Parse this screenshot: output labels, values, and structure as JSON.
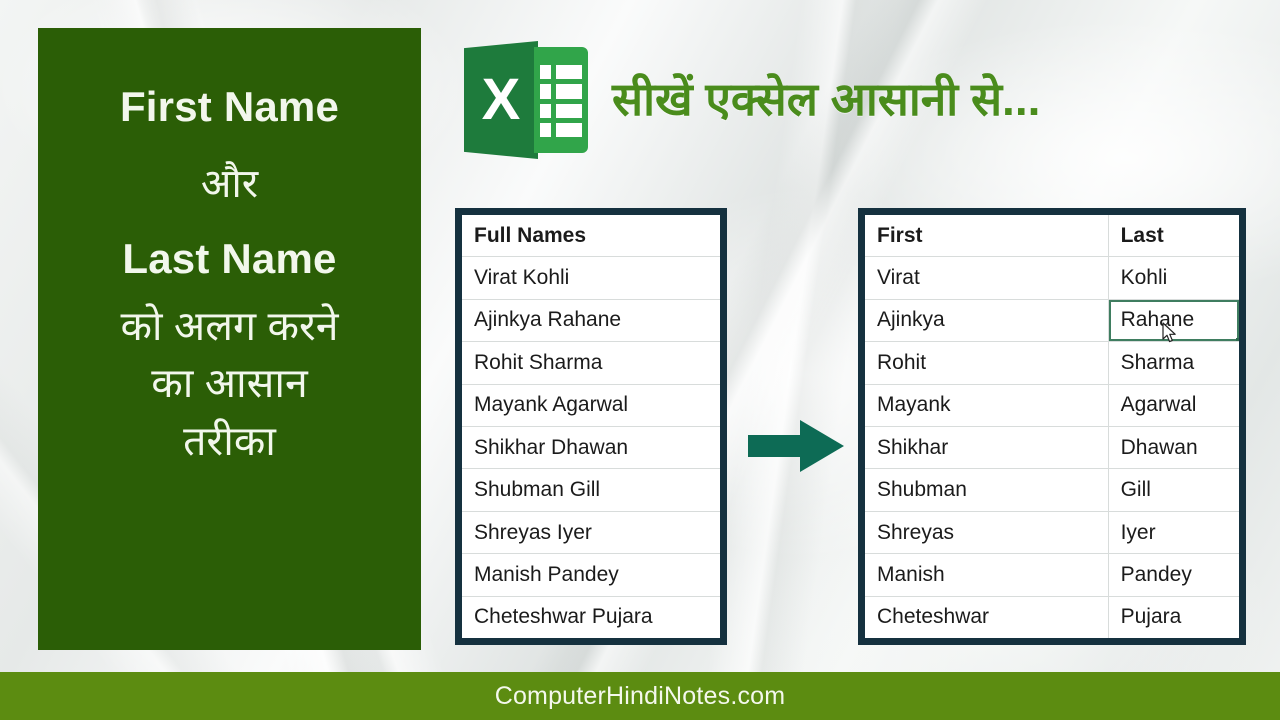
{
  "colors": {
    "panel_green": "#2b5e06",
    "tagline_green": "#4a8c1c",
    "footer_green": "#5c8c11",
    "table_border": "#15313f",
    "arrow_teal": "#0d6b55",
    "excel_dark": "#1e7b3c",
    "excel_light": "#31a54a",
    "selection_green": "#3f7d60"
  },
  "title_panel": {
    "line1": "First Name",
    "line2": "और",
    "line3": "Last Name",
    "line4": "को अलग करने",
    "line5": "का आसान",
    "line6": "तरीका"
  },
  "header": {
    "logo_letter": "X",
    "logo_name": "excel-logo",
    "tagline": "सीखें एक्सेल आसानी से..."
  },
  "arrow": {
    "name": "right-arrow-icon",
    "direction": "right"
  },
  "table_left": {
    "name": "full-names-table",
    "columns": [
      "Full Names"
    ],
    "rows": [
      [
        "Virat Kohli"
      ],
      [
        "Ajinkya Rahane"
      ],
      [
        "Rohit Sharma"
      ],
      [
        "Mayank Agarwal"
      ],
      [
        "Shikhar Dhawan"
      ],
      [
        "Shubman Gill"
      ],
      [
        "Shreyas Iyer"
      ],
      [
        "Manish Pandey"
      ],
      [
        "Cheteshwar Pujara"
      ]
    ]
  },
  "table_right": {
    "name": "split-names-table",
    "columns": [
      "First",
      "Last"
    ],
    "selected_cell": {
      "row": 2,
      "column": "Last",
      "value": "Rahane"
    },
    "rows": [
      [
        "Virat",
        "Kohli"
      ],
      [
        "Ajinkya",
        "Rahane"
      ],
      [
        "Rohit",
        "Sharma"
      ],
      [
        "Mayank",
        "Agarwal"
      ],
      [
        "Shikhar",
        "Dhawan"
      ],
      [
        "Shubman",
        "Gill"
      ],
      [
        "Shreyas",
        "Iyer"
      ],
      [
        "Manish",
        "Pandey"
      ],
      [
        "Cheteshwar",
        "Pujara"
      ]
    ]
  },
  "footer": {
    "brand": "ComputerHindiNotes.com"
  }
}
